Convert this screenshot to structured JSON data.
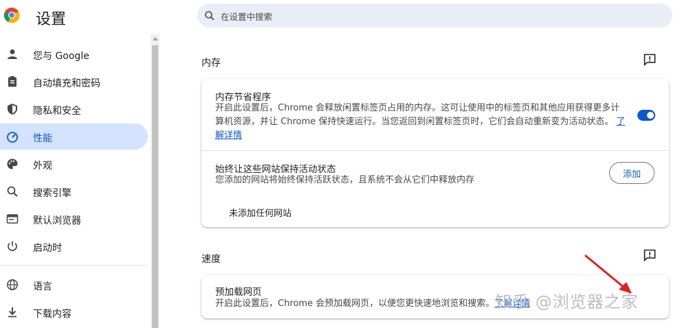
{
  "header": {
    "title": "设置"
  },
  "search": {
    "placeholder": "在设置中搜索"
  },
  "sidebar": {
    "items": [
      {
        "label": "您与 Google",
        "icon": "person-icon",
        "active": false
      },
      {
        "label": "自动填充和密码",
        "icon": "clipboard-icon",
        "active": false
      },
      {
        "label": "隐私和安全",
        "icon": "shield-icon",
        "active": false
      },
      {
        "label": "性能",
        "icon": "speedometer-icon",
        "active": true
      },
      {
        "label": "外观",
        "icon": "palette-icon",
        "active": false
      },
      {
        "label": "搜索引擎",
        "icon": "search-icon",
        "active": false
      },
      {
        "label": "默认浏览器",
        "icon": "browser-window-icon",
        "active": false
      },
      {
        "label": "启动时",
        "icon": "power-icon",
        "active": false
      },
      {
        "label": "语言",
        "icon": "globe-icon",
        "active": false
      },
      {
        "label": "下载内容",
        "icon": "download-icon",
        "active": false
      }
    ]
  },
  "memory": {
    "title": "内存",
    "saver": {
      "title": "内存节省程序",
      "desc_line1": "开启此设置后，Chrome 会释放闲置标签页占用的内存。这可让使用中的标签页和其他应用获得更多计",
      "desc_line2": "算机资源，并让 Chrome 保持快速运行。当您返回到闲置标签页时，它们会自动重新变为活动状态。",
      "link_part1": "了",
      "link_part2": "解详情",
      "enabled": true
    },
    "always_active": {
      "title": "始终让这些网站保持活动状态",
      "desc": "您添加的网站将始终保持活跃状态，且系统不会从它们中释放内存",
      "add_label": "添加",
      "empty_text": "未添加任何网站"
    }
  },
  "speed": {
    "title": "速度",
    "preload": {
      "title": "预加载网页",
      "desc": "开启此设置后，Chrome 会预加载网页，以便您更快速地浏览和搜索。",
      "link": "了解详情"
    }
  },
  "watermark": "知乎 @浏览器之家",
  "colors": {
    "accent": "#0b57d0",
    "active_bg": "#d3e3fd",
    "annotation": "#e02020"
  }
}
